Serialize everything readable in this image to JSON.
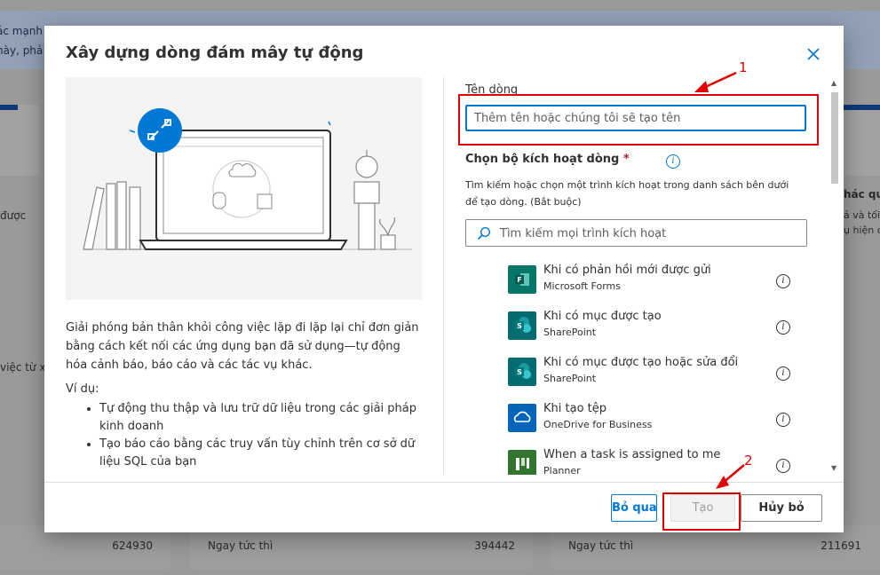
{
  "background": {
    "banner_line1": "ác mạnh",
    "banner_line2": "này, phả",
    "left_snippet_1": "được",
    "left_snippet_2": "việc từ x",
    "right_snippet_1": "hác qu",
    "right_snippet_2": "ả và tối",
    "right_snippet_3": "ụ hiện c",
    "bottom_cards": [
      {
        "label": "",
        "value": "624930"
      },
      {
        "label": "Ngay tức thì",
        "value": "394442"
      },
      {
        "label": "Ngay tức thì",
        "value": "211691"
      }
    ]
  },
  "dialog": {
    "title": "Xây dựng dòng đám mây tự động",
    "description": "Giải phóng bản thân khỏi công việc lặp đi lặp lại chỉ đơn giản bằng cách kết nối các ứng dụng bạn đã sử dụng—tự động hóa cảnh báo, báo cáo và các tác vụ khác.",
    "example_label": "Ví dụ:",
    "examples": [
      "Tự động thu thập và lưu trữ dữ liệu trong các giải pháp kinh doanh",
      "Tạo báo cáo bằng các truy vấn tùy chỉnh trên cơ sở dữ liệu SQL của bạn"
    ],
    "flow_name_label": "Tên dòng",
    "flow_name_value": "",
    "flow_name_placeholder": "Thêm tên hoặc chúng tôi sẽ tạo tên",
    "trigger_label": "Chọn bộ kích hoạt dòng",
    "trigger_required": "*",
    "trigger_help": "Tìm kiếm hoặc chọn một trình kích hoạt trong danh sách bên dưới để tạo dòng. (Bắt buộc)",
    "search_placeholder": "Tìm kiếm mọi trình kích hoạt",
    "triggers": [
      {
        "name": "Khi có phản hồi mới được gửi",
        "connector": "Microsoft Forms",
        "icon": "forms-icon",
        "color": "#077568"
      },
      {
        "name": "Khi có mục được tạo",
        "connector": "SharePoint",
        "icon": "sharepoint-icon",
        "color": "#036c70"
      },
      {
        "name": "Khi có mục được tạo hoặc sửa đổi",
        "connector": "SharePoint",
        "icon": "sharepoint-icon",
        "color": "#036c70"
      },
      {
        "name": "Khi tạo tệp",
        "connector": "OneDrive for Business",
        "icon": "onedrive-icon",
        "color": "#0364b8"
      },
      {
        "name": "When a task is assigned to me",
        "connector": "Planner",
        "icon": "planner-icon",
        "color": "#31752f"
      }
    ],
    "buttons": {
      "skip": "Bỏ qua",
      "create": "Tạo",
      "cancel": "Hủy bỏ"
    }
  },
  "annotations": {
    "label_1": "1",
    "label_2": "2",
    "color": "#e00000"
  }
}
